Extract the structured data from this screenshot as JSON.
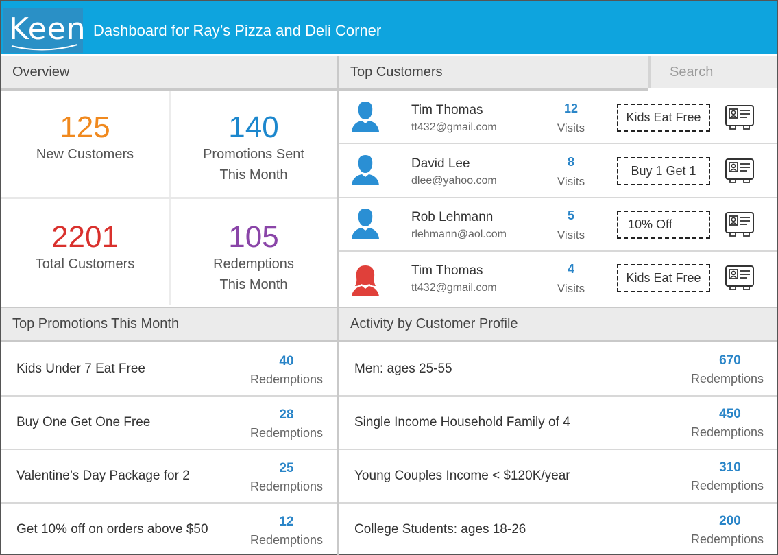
{
  "header": {
    "logo": "Keen",
    "title": "Dashboard for Ray’s Pizza and Deli Corner"
  },
  "overview": {
    "title": "Overview",
    "stats": [
      {
        "value": "125",
        "label": "New Customers",
        "color": "#f0891e"
      },
      {
        "value": "140",
        "label": "Promotions Sent This Month",
        "color": "#1c87cd"
      },
      {
        "value": "2201",
        "label": "Total Customers",
        "color": "#d9312d"
      },
      {
        "value": "105",
        "label": "Redemptions This Month",
        "color": "#8a45a8"
      }
    ]
  },
  "top_customers": {
    "title": "Top Customers",
    "search_placeholder": "Search",
    "customers": [
      {
        "name": "Tim Thomas",
        "email": "tt432@gmail.com",
        "visits": "12",
        "visits_label": "Visits",
        "promo": "Kids Eat Free",
        "avatar": "male-user-icon",
        "avatar_color": "#2a8fd4"
      },
      {
        "name": "David Lee",
        "email": "dlee@yahoo.com",
        "visits": "8",
        "visits_label": "Visits",
        "promo": "Buy 1 Get 1",
        "avatar": "male-user-icon",
        "avatar_color": "#2a8fd4"
      },
      {
        "name": "Rob Lehmann",
        "email": "rlehmann@aol.com",
        "visits": "5",
        "visits_label": "Visits",
        "promo": "10% Off",
        "avatar": "male-user-icon",
        "avatar_color": "#2a8fd4"
      },
      {
        "name": "Tim Thomas",
        "email": "tt432@gmail.com",
        "visits": "4",
        "visits_label": "Visits",
        "promo": "Kids Eat Free",
        "avatar": "female-user-icon",
        "avatar_color": "#e0403a"
      }
    ]
  },
  "top_promotions": {
    "title": "Top Promotions This Month",
    "items": [
      {
        "label": "Kids Under 7 Eat Free",
        "value": "40",
        "unit": "Redemptions"
      },
      {
        "label": "Buy One Get One Free",
        "value": "28",
        "unit": "Redemptions"
      },
      {
        "label": "Valentine’s Day Package for 2",
        "value": "25",
        "unit": "Redemptions"
      },
      {
        "label": "Get 10% off on orders above $50",
        "value": "12",
        "unit": "Redemptions"
      }
    ]
  },
  "activity": {
    "title": "Activity by Customer Profile",
    "items": [
      {
        "label": "Men: ages 25-55",
        "value": "670",
        "unit": "Redemptions"
      },
      {
        "label": "Single Income Household Family of 4",
        "value": "450",
        "unit": "Redemptions"
      },
      {
        "label": "Young Couples Income < $120K/year",
        "value": "310",
        "unit": "Redemptions"
      },
      {
        "label": "College Students: ages 18-26",
        "value": "200",
        "unit": "Redemptions"
      }
    ]
  }
}
